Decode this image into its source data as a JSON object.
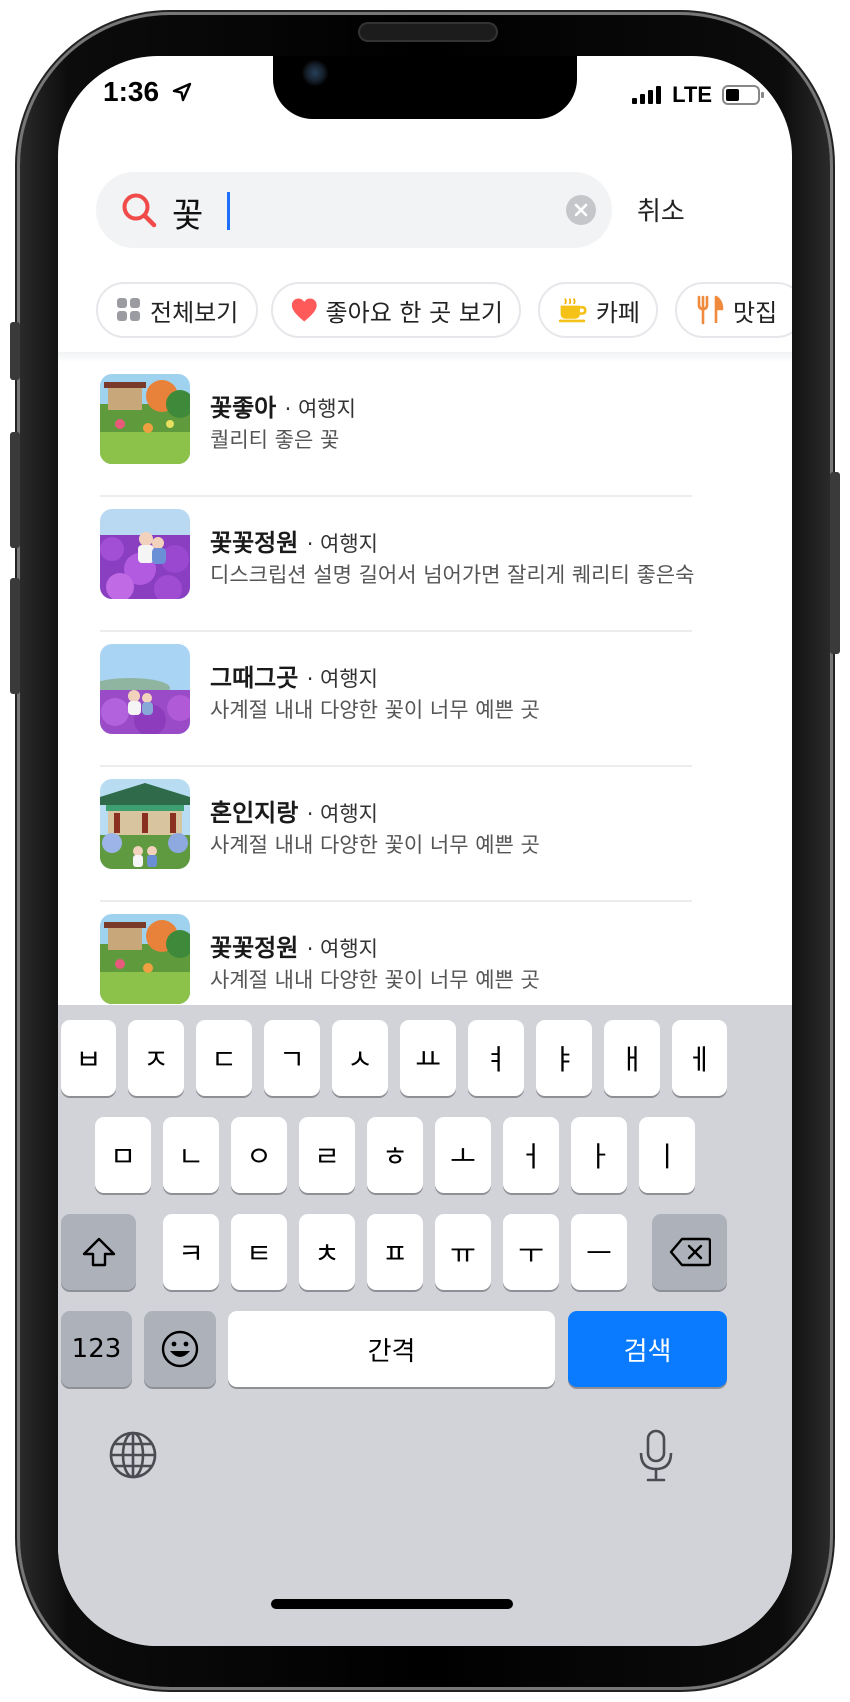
{
  "status_bar": {
    "time": "1:36",
    "network": "LTE"
  },
  "search": {
    "query": "꽃",
    "cancel_label": "취소"
  },
  "chips": [
    {
      "label": "전체보기",
      "icon": "grid-icon"
    },
    {
      "label": "좋아요 한 곳 보기",
      "icon": "heart-icon"
    },
    {
      "label": "카페",
      "icon": "coffee-cup-icon"
    },
    {
      "label": "맛집",
      "icon": "fork-knife-icon"
    }
  ],
  "results": [
    {
      "name": "꽃좋아",
      "category": "· 여행지",
      "description": "퀄리티 좋은 꽃",
      "thumb": "garden-pavilion"
    },
    {
      "name": "꽃꽃정원",
      "category": "· 여행지",
      "description": "디스크립션 설명 길어서 넘어가면 잘리게 퀘리티 좋은숙",
      "thumb": "purple-flowers-couple"
    },
    {
      "name": "그때그곳",
      "category": "· 여행지",
      "description": "사계절 내내 다양한 꽃이 너무 예쁜 곳",
      "thumb": "purple-flowers-sky"
    },
    {
      "name": "혼인지랑",
      "category": "· 여행지",
      "description": "사계절 내내 다양한 꽃이 너무 예쁜 곳",
      "thumb": "hanok-hydrangea"
    },
    {
      "name": "꽃꽃정원",
      "category": "· 여행지",
      "description": "사계절 내내 다양한 꽃이 너무 예쁜 곳",
      "thumb": "garden-pavilion"
    }
  ],
  "keyboard": {
    "row1": [
      "ㅂ",
      "ㅈ",
      "ㄷ",
      "ㄱ",
      "ㅅ",
      "ㅛ",
      "ㅕ",
      "ㅑ",
      "ㅐ",
      "ㅔ"
    ],
    "row2": [
      "ㅁ",
      "ㄴ",
      "ㅇ",
      "ㄹ",
      "ㅎ",
      "ㅗ",
      "ㅓ",
      "ㅏ",
      "ㅣ"
    ],
    "row3": [
      "ㅋ",
      "ㅌ",
      "ㅊ",
      "ㅍ",
      "ㅠ",
      "ㅜ",
      "ㅡ"
    ],
    "numbers_label": "123",
    "space_label": "간격",
    "search_label": "검색"
  },
  "colors": {
    "accent": "#0a7bff",
    "search_icon": "#f04a4a",
    "heart": "#ff5a5a"
  }
}
